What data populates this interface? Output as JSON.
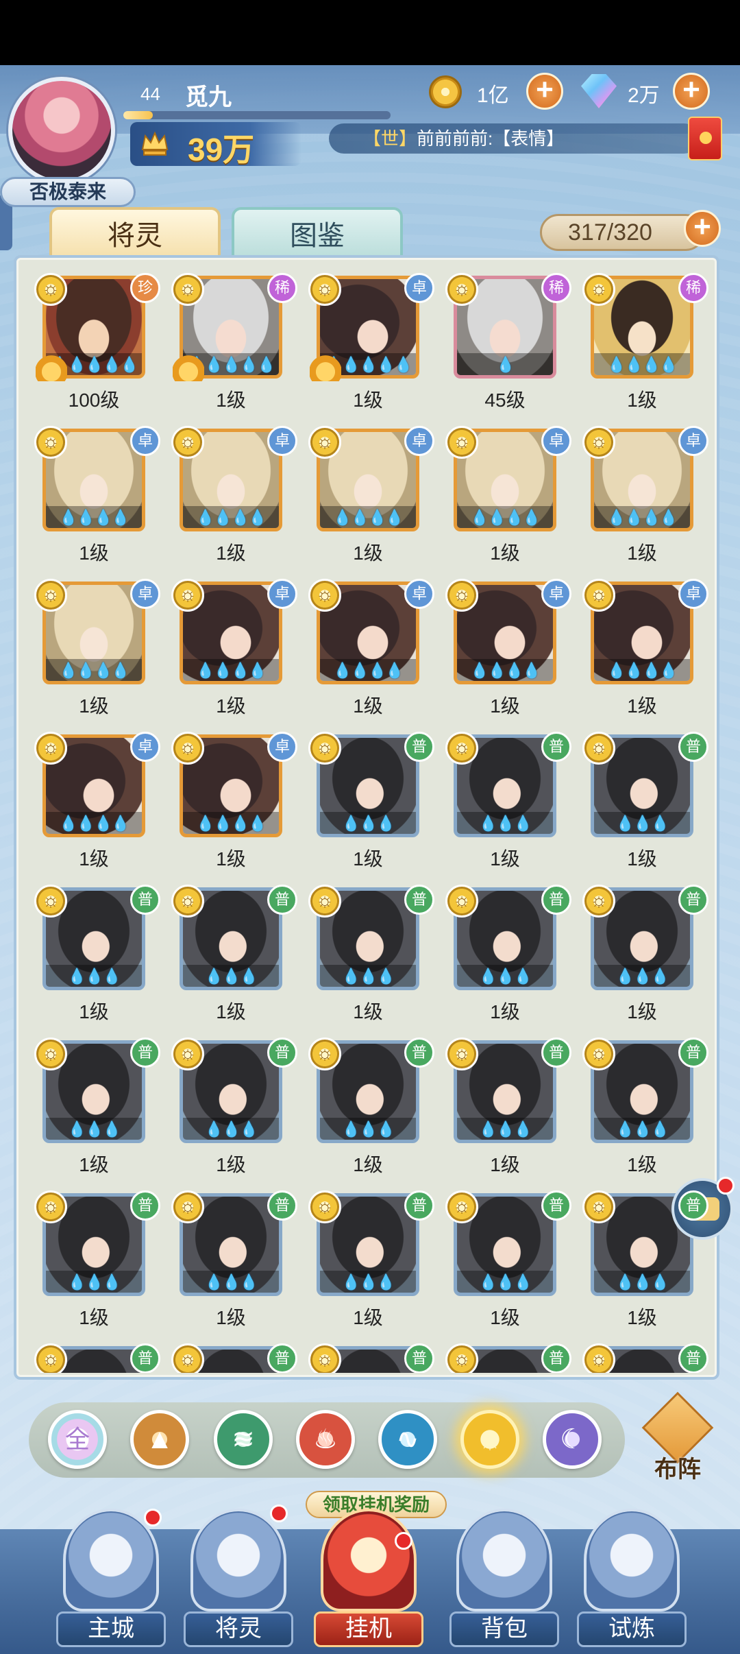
{
  "player": {
    "level": "44",
    "name": "觅九",
    "title": "否极泰来",
    "exp_fraction": 0.11,
    "power": "39万"
  },
  "resources": {
    "gold": "1亿",
    "diamonds": "2万"
  },
  "world_chat": {
    "channel": "【世】",
    "message": "前前前前:【表情】"
  },
  "tabs": {
    "spirits": "将灵",
    "codex": "图鉴"
  },
  "capacity": "317/320",
  "element_glyph": "☼",
  "heroes": [
    {
      "level": "100级",
      "rarity": "珍",
      "rarity_color": "#e68a45",
      "art": "brown",
      "frame": "gold",
      "stars": "💧💧💧💧💧",
      "crest": true
    },
    {
      "level": "1级",
      "rarity": "稀",
      "rarity_color": "#c063d8",
      "art": "silver",
      "frame": "gold",
      "stars": "💧💧💧💧💧",
      "crest": true
    },
    {
      "level": "1级",
      "rarity": "卓",
      "rarity_color": "#5f96d6",
      "art": "dark",
      "frame": "gold",
      "stars": "💧💧💧💧💧",
      "crest": true
    },
    {
      "level": "45级",
      "rarity": "稀",
      "rarity_color": "#c063d8",
      "art": "silver",
      "frame": "pink",
      "stars": "💧",
      "crest": false
    },
    {
      "level": "1级",
      "rarity": "稀",
      "rarity_color": "#c063d8",
      "art": "gold",
      "frame": "gold2",
      "stars": "💧💧💧💧",
      "crest": false
    },
    {
      "level": "1级",
      "rarity": "卓",
      "rarity_color": "#5f96d6",
      "art": "blond",
      "frame": "gold",
      "stars": "💧💧💧💧",
      "crest": false
    },
    {
      "level": "1级",
      "rarity": "卓",
      "rarity_color": "#5f96d6",
      "art": "blond",
      "frame": "gold",
      "stars": "💧💧💧💧",
      "crest": false
    },
    {
      "level": "1级",
      "rarity": "卓",
      "rarity_color": "#5f96d6",
      "art": "blond",
      "frame": "gold",
      "stars": "💧💧💧💧",
      "crest": false
    },
    {
      "level": "1级",
      "rarity": "卓",
      "rarity_color": "#5f96d6",
      "art": "blond",
      "frame": "gold",
      "stars": "💧💧💧💧",
      "crest": false
    },
    {
      "level": "1级",
      "rarity": "卓",
      "rarity_color": "#5f96d6",
      "art": "blond",
      "frame": "gold",
      "stars": "💧💧💧💧",
      "crest": false
    },
    {
      "level": "1级",
      "rarity": "卓",
      "rarity_color": "#5f96d6",
      "art": "blond",
      "frame": "gold",
      "stars": "💧💧💧💧",
      "crest": false
    },
    {
      "level": "1级",
      "rarity": "卓",
      "rarity_color": "#5f96d6",
      "art": "dark",
      "frame": "gold",
      "stars": "💧💧💧💧",
      "crest": false
    },
    {
      "level": "1级",
      "rarity": "卓",
      "rarity_color": "#5f96d6",
      "art": "dark",
      "frame": "gold",
      "stars": "💧💧💧💧",
      "crest": false
    },
    {
      "level": "1级",
      "rarity": "卓",
      "rarity_color": "#5f96d6",
      "art": "dark",
      "frame": "gold",
      "stars": "💧💧💧💧",
      "crest": false
    },
    {
      "level": "1级",
      "rarity": "卓",
      "rarity_color": "#5f96d6",
      "art": "dark",
      "frame": "gold",
      "stars": "💧💧💧💧",
      "crest": false
    },
    {
      "level": "1级",
      "rarity": "卓",
      "rarity_color": "#5f96d6",
      "art": "dark",
      "frame": "gold",
      "stars": "💧💧💧💧",
      "crest": false
    },
    {
      "level": "1级",
      "rarity": "卓",
      "rarity_color": "#5f96d6",
      "art": "dark",
      "frame": "gold",
      "stars": "💧💧💧💧",
      "crest": false
    },
    {
      "level": "1级",
      "rarity": "普",
      "rarity_color": "#49a860",
      "art": "black",
      "frame": "blue",
      "stars": "💧💧💧",
      "crest": false
    },
    {
      "level": "1级",
      "rarity": "普",
      "rarity_color": "#49a860",
      "art": "black",
      "frame": "blue",
      "stars": "💧💧💧",
      "crest": false
    },
    {
      "level": "1级",
      "rarity": "普",
      "rarity_color": "#49a860",
      "art": "black",
      "frame": "blue",
      "stars": "💧💧💧",
      "crest": false
    },
    {
      "level": "1级",
      "rarity": "普",
      "rarity_color": "#49a860",
      "art": "black",
      "frame": "blue",
      "stars": "💧💧💧",
      "crest": false
    },
    {
      "level": "1级",
      "rarity": "普",
      "rarity_color": "#49a860",
      "art": "black",
      "frame": "blue",
      "stars": "💧💧💧",
      "crest": false
    },
    {
      "level": "1级",
      "rarity": "普",
      "rarity_color": "#49a860",
      "art": "black",
      "frame": "blue",
      "stars": "💧💧💧",
      "crest": false
    },
    {
      "level": "1级",
      "rarity": "普",
      "rarity_color": "#49a860",
      "art": "black",
      "frame": "blue",
      "stars": "💧💧💧",
      "crest": false
    },
    {
      "level": "1级",
      "rarity": "普",
      "rarity_color": "#49a860",
      "art": "black",
      "frame": "blue",
      "stars": "💧💧💧",
      "crest": false
    },
    {
      "level": "1级",
      "rarity": "普",
      "rarity_color": "#49a860",
      "art": "black",
      "frame": "blue",
      "stars": "💧💧💧",
      "crest": false
    },
    {
      "level": "1级",
      "rarity": "普",
      "rarity_color": "#49a860",
      "art": "black",
      "frame": "blue",
      "stars": "💧💧💧",
      "crest": false
    },
    {
      "level": "1级",
      "rarity": "普",
      "rarity_color": "#49a860",
      "art": "black",
      "frame": "blue",
      "stars": "💧💧💧",
      "crest": false
    },
    {
      "level": "1级",
      "rarity": "普",
      "rarity_color": "#49a860",
      "art": "black",
      "frame": "blue",
      "stars": "💧💧💧",
      "crest": false
    },
    {
      "level": "1级",
      "rarity": "普",
      "rarity_color": "#49a860",
      "art": "black",
      "frame": "blue",
      "stars": "💧💧💧",
      "crest": false
    },
    {
      "level": "1级",
      "rarity": "普",
      "rarity_color": "#49a860",
      "art": "black",
      "frame": "blue",
      "stars": "💧💧💧",
      "crest": false
    },
    {
      "level": "1级",
      "rarity": "普",
      "rarity_color": "#49a860",
      "art": "black",
      "frame": "blue",
      "stars": "💧💧💧",
      "crest": false
    },
    {
      "level": "1级",
      "rarity": "普",
      "rarity_color": "#49a860",
      "art": "black",
      "frame": "blue",
      "stars": "💧💧💧",
      "crest": false
    },
    {
      "level": "1级",
      "rarity": "普",
      "rarity_color": "#49a860",
      "art": "black",
      "frame": "blue",
      "stars": "💧💧💧",
      "crest": false
    },
    {
      "level": "1级",
      "rarity": "普",
      "rarity_color": "#49a860",
      "art": "black",
      "frame": "blue",
      "stars": "💧💧💧",
      "crest": false
    },
    {
      "level": "",
      "rarity": "普",
      "rarity_color": "#49a860",
      "art": "black",
      "frame": "blue",
      "stars": "",
      "crest": false
    },
    {
      "level": "",
      "rarity": "普",
      "rarity_color": "#49a860",
      "art": "black",
      "frame": "blue",
      "stars": "",
      "crest": false
    },
    {
      "level": "",
      "rarity": "普",
      "rarity_color": "#49a860",
      "art": "black",
      "frame": "blue",
      "stars": "",
      "crest": false
    },
    {
      "level": "",
      "rarity": "普",
      "rarity_color": "#49a860",
      "art": "black",
      "frame": "blue",
      "stars": "",
      "crest": false
    },
    {
      "level": "",
      "rarity": "普",
      "rarity_color": "#49a860",
      "art": "black",
      "frame": "blue",
      "stars": "",
      "crest": false
    }
  ],
  "filters": {
    "all": "全",
    "earth_icon": "mountain-icon",
    "wind_icon": "tornado-icon",
    "fire_icon": "flame-icon",
    "water_icon": "wave-icon",
    "light_icon": "sun-icon",
    "dark_icon": "moon-icon"
  },
  "formation_label": "布阵",
  "idle_claim": "领取挂机奖励",
  "nav": {
    "city": "主城",
    "spirits": "将灵",
    "idle": "挂机",
    "bag": "背包",
    "trial": "试炼"
  },
  "colors": {
    "accent_gold": "#f1be2c",
    "badge_red": "#e6292a",
    "power_text": "#ffd766"
  }
}
